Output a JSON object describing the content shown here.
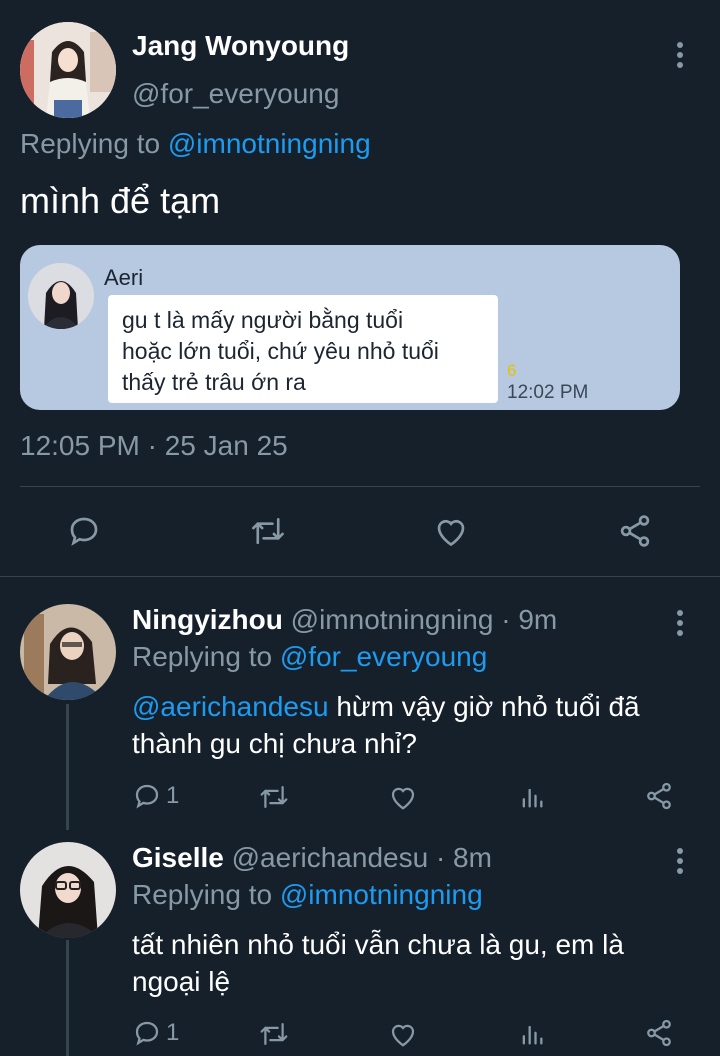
{
  "main_tweet": {
    "display_name": "Jang Wonyoung",
    "handle": "@for_everyoung",
    "replying_prefix": "Replying to",
    "replying_handle": "@imnotningning",
    "text": "mình để tạm",
    "timestamp": "12:05 PM · 25 Jan 25",
    "embedded_chat": {
      "sender": "Aeri",
      "message_lines": [
        "gu t là mấy người bằng tuổi",
        "hoặc lớn tuổi, chứ yêu nhỏ tuổi",
        "thấy trẻ trâu ớn ra"
      ],
      "counter": "6",
      "time": "12:02 PM"
    }
  },
  "replies": [
    {
      "display_name": "Ningyizhou",
      "handle": "@imnotningning",
      "age": "· 9m",
      "replying_prefix": "Replying to",
      "replying_handle": "@for_everyoung",
      "mention": "@aerichandesu",
      "text": " hừm vậy giờ nhỏ tuổi đã thành gu chị chưa nhỉ?",
      "reply_count": "1"
    },
    {
      "display_name": "Giselle",
      "handle": "@aerichandesu",
      "age": "· 8m",
      "replying_prefix": "Replying to",
      "replying_handle": "@imnotningning",
      "text": "tất nhiên nhỏ tuổi vẫn chưa là gu, em là ngoại lệ",
      "reply_count": "1"
    }
  ],
  "colors": {
    "background": "#15202b",
    "link": "#1d9bf0",
    "muted": "#8899a6",
    "chat_bubble": "#b7c9e0"
  },
  "icons": [
    "more-vertical-icon",
    "reply-icon",
    "retweet-icon",
    "like-icon",
    "share-icon",
    "analytics-icon"
  ]
}
